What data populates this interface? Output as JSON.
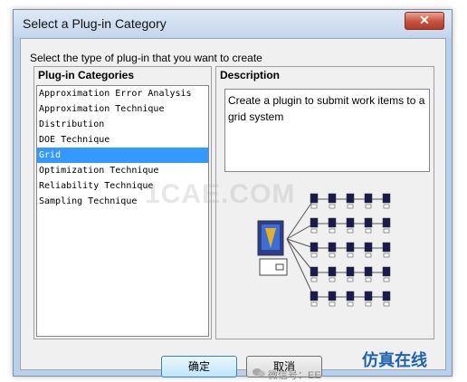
{
  "window": {
    "title": "Select a Plug-in Category",
    "close_label": "✕"
  },
  "prompt": "Select the type of plug-in that you want to create",
  "categories": {
    "title": "Plug-in Categories",
    "items": [
      "Approximation Error Analysis",
      "Approximation Technique",
      "Distribution",
      "DOE Technique",
      "Grid",
      "Optimization Technique",
      "Reliability Technique",
      "Sampling Technique"
    ],
    "selected": "Grid"
  },
  "description": {
    "title": "Description",
    "text": "Create a plugin to submit work items to a grid system"
  },
  "buttons": {
    "ok": "确定",
    "cancel": "取消"
  },
  "watermark": "1CAE.COM",
  "overlay": {
    "brand": "仿真在线",
    "wechat": "微信号：EE"
  },
  "colors": {
    "selection": "#3399ff",
    "title_bar": "#c4d6ec",
    "brand": "#1e63b0"
  }
}
